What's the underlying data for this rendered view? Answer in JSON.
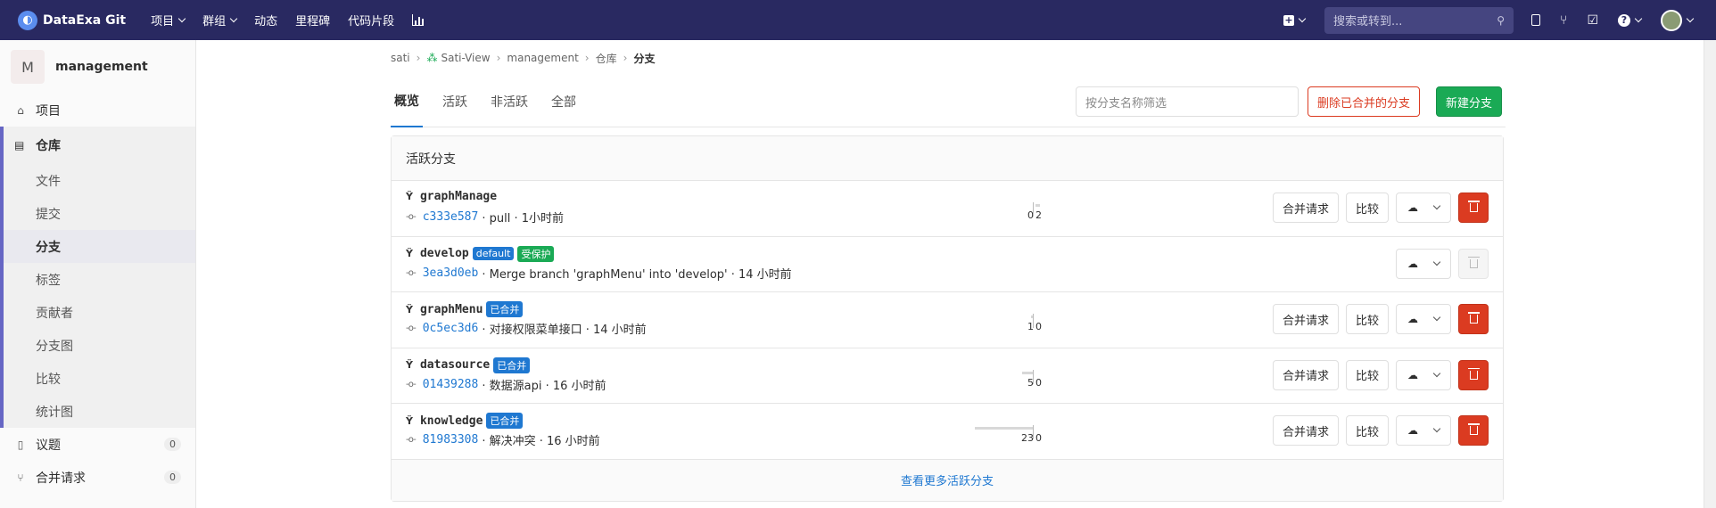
{
  "topbar": {
    "brand": "DataExa Git",
    "nav": [
      {
        "label": "项目",
        "dropdown": true
      },
      {
        "label": "群组",
        "dropdown": true
      },
      {
        "label": "动态",
        "dropdown": false
      },
      {
        "label": "里程碑",
        "dropdown": false
      },
      {
        "label": "代码片段",
        "dropdown": false
      }
    ],
    "search_placeholder": "搜索或转到..."
  },
  "sidebar": {
    "project_initial": "M",
    "project_name": "management",
    "items": {
      "project": "项目",
      "repo": "仓库",
      "files": "文件",
      "commits": "提交",
      "branches": "分支",
      "tags": "标签",
      "contributors": "贡献者",
      "graph": "分支图",
      "compare": "比较",
      "charts": "统计图",
      "issues": "议题",
      "issues_count": "0",
      "mrs": "合并请求",
      "mrs_count": "0"
    }
  },
  "breadcrumb": {
    "group": "sati",
    "project": "Sati-View",
    "sub": "management",
    "repo": "仓库",
    "current": "分支"
  },
  "tabs": [
    "概览",
    "活跃",
    "非活跃",
    "全部"
  ],
  "filter_placeholder": "按分支名称筛选",
  "buttons": {
    "delete_merged": "删除已合并的分支",
    "new_branch": "新建分支",
    "merge_request": "合并请求",
    "compare": "比较"
  },
  "panel_title": "活跃分支",
  "branches": [
    {
      "name": "graphManage",
      "tags": [],
      "sha": "c333e587",
      "message": "· pull · 1小时前",
      "behind": "0",
      "ahead": "2",
      "behind_frac": 0.0,
      "ahead_frac": 0.08,
      "can_delete": true,
      "show_mr": true
    },
    {
      "name": "develop",
      "tags": [
        {
          "label": "default",
          "color": "blue"
        },
        {
          "label": "受保护",
          "color": "green"
        }
      ],
      "sha": "3ea3d0eb",
      "message": "· Merge branch 'graphMenu' into 'develop' · 14 小时前",
      "behind": "",
      "ahead": "",
      "behind_frac": 0.0,
      "ahead_frac": 0.0,
      "can_delete": false,
      "show_mr": false
    },
    {
      "name": "graphMenu",
      "tags": [
        {
          "label": "已合并",
          "color": "blue"
        }
      ],
      "sha": "0c5ec3d6",
      "message": "· 对接权限菜单接口 · 14 小时前",
      "behind": "1",
      "ahead": "0",
      "behind_frac": 0.04,
      "ahead_frac": 0.0,
      "can_delete": true,
      "show_mr": true
    },
    {
      "name": "datasource",
      "tags": [
        {
          "label": "已合并",
          "color": "blue"
        }
      ],
      "sha": "01439288",
      "message": "· 数据源api · 16 小时前",
      "behind": "5",
      "ahead": "0",
      "behind_frac": 0.2,
      "ahead_frac": 0.0,
      "can_delete": true,
      "show_mr": true
    },
    {
      "name": "knowledge",
      "tags": [
        {
          "label": "已合并",
          "color": "blue"
        }
      ],
      "sha": "81983308",
      "message": "· 解决冲突 · 16 小时前",
      "behind": "23",
      "ahead": "0",
      "behind_frac": 1.0,
      "ahead_frac": 0.0,
      "can_delete": true,
      "show_mr": true
    }
  ],
  "footer_link": "查看更多活跃分支",
  "colors": {
    "topbar": "#292961",
    "primary": "#1f78d1",
    "danger": "#db3b21",
    "success": "#1aaa55"
  }
}
